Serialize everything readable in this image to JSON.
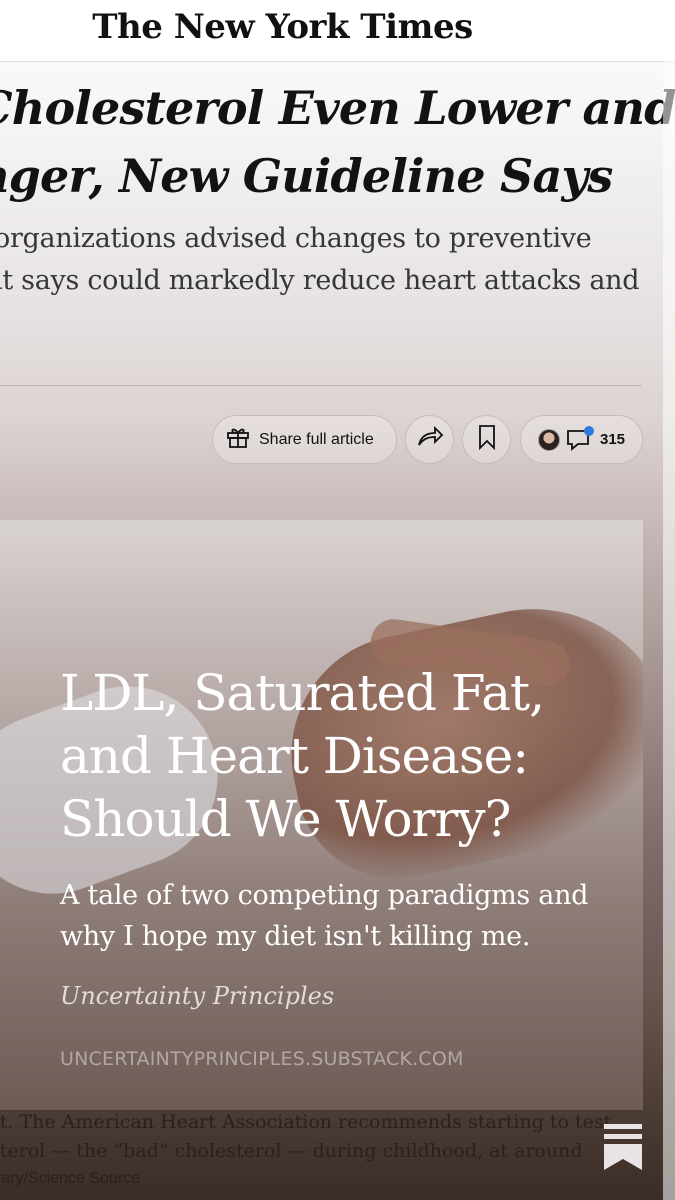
{
  "masthead": {
    "logo_text": "The New York Times"
  },
  "article": {
    "headline_lines": [
      "Cholesterol Even Lower and",
      "nger, New Guideline Says"
    ],
    "dek_lines": [
      "organizations advised changes to preventive",
      "it says could markedly reduce heart attacks and"
    ]
  },
  "actions": {
    "share_label": "Share full article",
    "comment_count": "315",
    "icons": [
      "gift-icon",
      "forward-icon",
      "bookmark-icon",
      "comment-icon"
    ]
  },
  "substack_card": {
    "title_lines": [
      "LDL, Saturated Fat,",
      "and Heart Disease:",
      "Should We Worry?"
    ],
    "subtitle_lines": [
      "A tale of two competing paradigms and",
      "why I hope my diet isn't killing me."
    ],
    "publication": "Uncertainty Principles",
    "url": "UNCERTAINTYPRINCIPLES.SUBSTACK.COM"
  },
  "photo_caption": {
    "lines": [
      "st. The American Heart Association recommends starting to test",
      "sterol — the “bad” cholesterol — during childhood, at around"
    ],
    "credit": "rary/Science Source"
  },
  "colors": {
    "accent_blue": "#2d7be0",
    "text_dark": "#121212"
  }
}
